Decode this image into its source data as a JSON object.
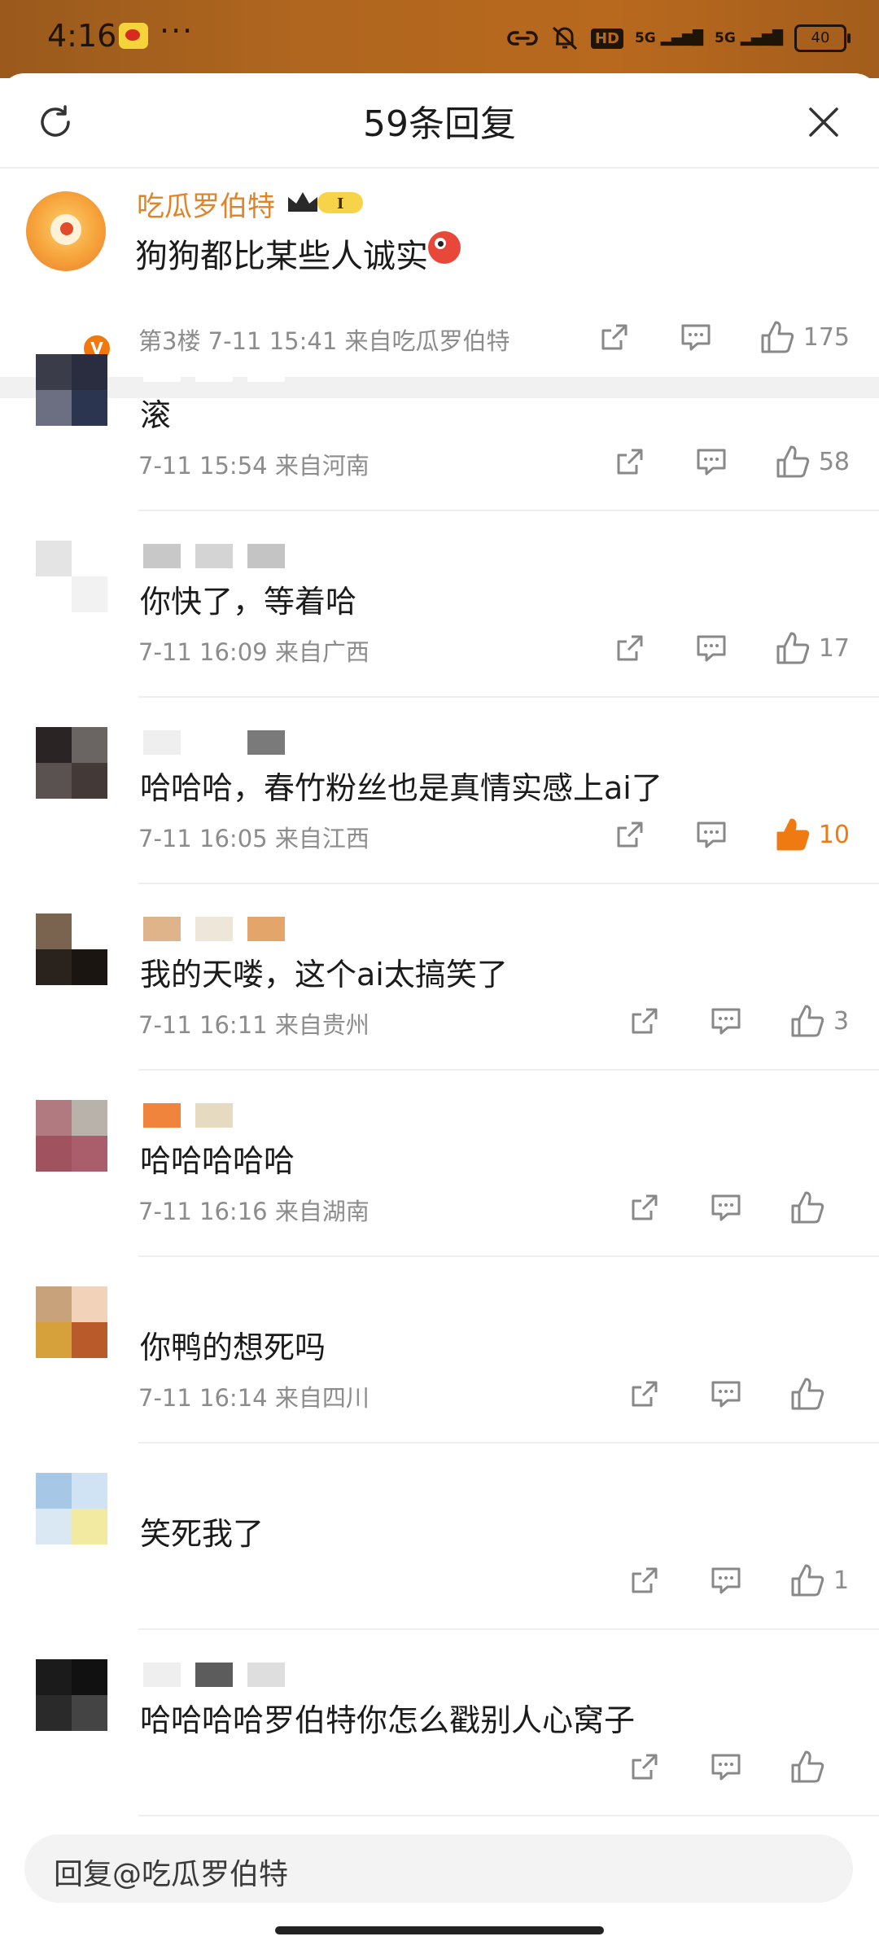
{
  "status_bar": {
    "time": "4:16",
    "more": "···",
    "hd": "HD",
    "signal1": "5G",
    "signal2": "5G",
    "battery": "40"
  },
  "header": {
    "title": "59条回复"
  },
  "main_comment": {
    "author": "吃瓜罗伯特",
    "text": "狗狗都比某些人诚实",
    "meta": "第3楼  7-11 15:41  来自吃瓜罗伯特",
    "likes": "175",
    "verified_mark": "V",
    "level_mark": "I"
  },
  "replies": [
    {
      "text": "滚",
      "meta": "7-11 15:54  来自河南",
      "likes": "58",
      "liked": false,
      "avatar": [
        "#3b3c4a",
        "#2a2d3f",
        "#6c6f82",
        "#2b3550"
      ],
      "name_blur": [
        "#ffffff",
        "#ffffff",
        "#ffffff"
      ]
    },
    {
      "text": "你快了，等着哈",
      "meta": "7-11 16:09  来自广西",
      "likes": "17",
      "liked": false,
      "avatar": [
        "#e4e4e4",
        "#ffffff",
        "#ffffff",
        "#f2f2f2"
      ],
      "name_blur": [
        "#c8c8c8",
        "#d4d4d4",
        "#c4c4c4"
      ]
    },
    {
      "text": "哈哈哈，春竹粉丝也是真情实感上ai了",
      "meta": "7-11 16:05  来自江西",
      "likes": "10",
      "liked": true,
      "avatar": [
        "#2b2424",
        "#6a6462",
        "#5a5250",
        "#433a38"
      ],
      "name_blur": [
        "#efefef",
        "#ffffff",
        "#7a7a7a"
      ]
    },
    {
      "text": "我的天喽，这个ai太搞笑了",
      "meta": "7-11 16:11  来自贵州",
      "likes": "3",
      "liked": false,
      "avatar": [
        "#7a6450",
        "#ffffff",
        "#2a221c",
        "#1b1512"
      ],
      "name_blur": [
        "#e0b48a",
        "#efe6da",
        "#e3a56a"
      ]
    },
    {
      "text": "哈哈哈哈哈",
      "meta": "7-11 16:16  来自湖南",
      "likes": "",
      "liked": false,
      "avatar": [
        "#b07a80",
        "#b8b2aa",
        "#a0525f",
        "#aa5e6c"
      ],
      "name_blur": [
        "#f0843c",
        "#e6dac0",
        "#ffffff"
      ]
    },
    {
      "text": "你鸭的想死吗",
      "meta": "7-11 16:14  来自四川",
      "likes": "",
      "liked": false,
      "avatar": [
        "#c7a27a",
        "#f2d2b8",
        "#d6a03a",
        "#b85a2a"
      ],
      "name_blur": [
        "#ffffff",
        "#ffffff",
        "#ffffff"
      ]
    },
    {
      "text": "笑死我了",
      "meta": "",
      "likes": "1",
      "liked": false,
      "avatar": [
        "#a6c8e6",
        "#cfe3f4",
        "#d9e8f2",
        "#f2eaa0"
      ],
      "name_blur": [
        "#ffffff",
        "#ffffff",
        "#ffffff"
      ]
    },
    {
      "text": "哈哈哈哈罗伯特你怎么戳别人心窝子",
      "meta": "",
      "likes": "",
      "liked": false,
      "avatar": [
        "#1b1b1b",
        "#111111",
        "#2a2a2a",
        "#444444"
      ],
      "name_blur": [
        "#efefef",
        "#5c5c5c",
        "#dedede"
      ]
    }
  ],
  "reply_input": {
    "placeholder": "回复@吃瓜罗伯特"
  },
  "icons": {
    "refresh": "refresh-icon",
    "close": "close-icon",
    "share": "share-icon",
    "comment": "comment-icon",
    "like": "thumbs-up-icon"
  },
  "colors": {
    "accent": "#f07a12",
    "name": "#e0842a",
    "meta": "#8c8c8c"
  }
}
